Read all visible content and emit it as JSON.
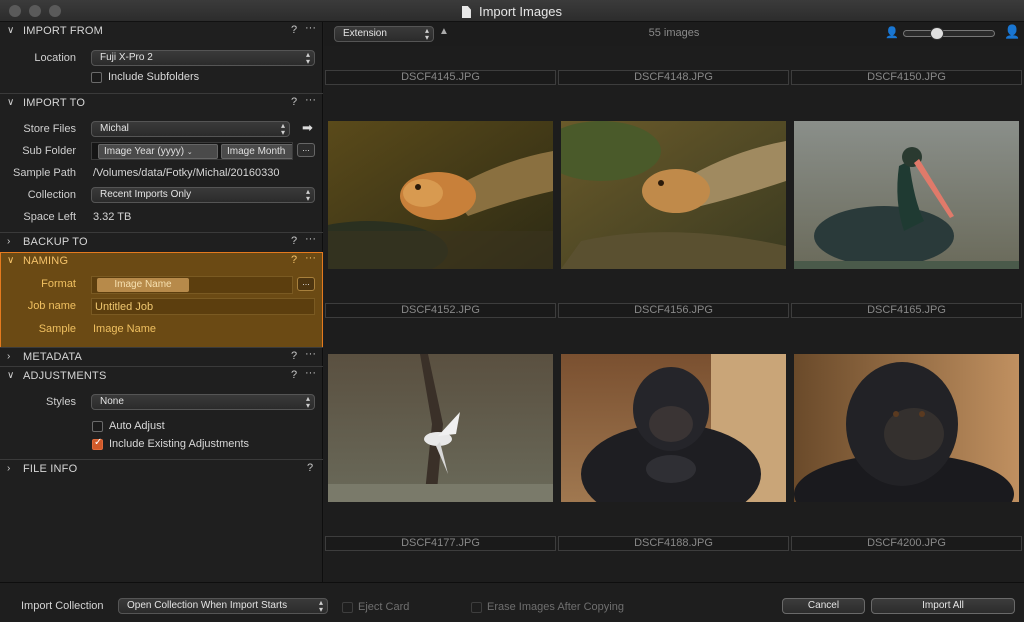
{
  "window": {
    "title": "Import Images"
  },
  "import_from": {
    "title": "IMPORT FROM",
    "location_label": "Location",
    "location_value": "Fuji X-Pro 2",
    "include_subfolders": "Include Subfolders"
  },
  "import_to": {
    "title": "IMPORT TO",
    "store_files_label": "Store Files",
    "store_files_value": "Michal",
    "sub_folder_label": "Sub Folder",
    "sub_folder_tokens": [
      "Image Year (yyyy)",
      "Image Month"
    ],
    "sample_path_label": "Sample Path",
    "sample_path_value": "/Volumes/data/Fotky/Michal/20160330",
    "collection_label": "Collection",
    "collection_value": "Recent Imports Only",
    "space_left_label": "Space Left",
    "space_left_value": "3.32 TB"
  },
  "backup_to": {
    "title": "BACKUP TO"
  },
  "naming": {
    "title": "NAMING",
    "format_label": "Format",
    "format_token": "Image Name",
    "job_name_label": "Job name",
    "job_name_value": "Untitled Job",
    "sample_label": "Sample",
    "sample_value": "Image Name"
  },
  "metadata": {
    "title": "METADATA"
  },
  "adjustments": {
    "title": "ADJUSTMENTS",
    "styles_label": "Styles",
    "styles_value": "None",
    "auto_adjust": "Auto Adjust",
    "include_existing": "Include Existing Adjustments"
  },
  "file_info": {
    "title": "FILE INFO"
  },
  "common": {
    "help": "?",
    "more": "···",
    "ellipsis": "..."
  },
  "browser": {
    "sort_value": "Extension",
    "image_count": "55 images",
    "rows": [
      [
        "DSCF4145.JPG",
        "DSCF4148.JPG",
        "DSCF4150.JPG"
      ],
      [
        "DSCF4152.JPG",
        "DSCF4156.JPG",
        "DSCF4165.JPG"
      ],
      [
        "DSCF4177.JPG",
        "DSCF4188.JPG",
        "DSCF4200.JPG"
      ]
    ]
  },
  "footer": {
    "import_collection_label": "Import Collection",
    "import_collection_value": "Open Collection When Import Starts",
    "eject_card": "Eject Card",
    "erase_images": "Erase Images After Copying",
    "cancel": "Cancel",
    "import_all": "Import All"
  },
  "colors": {
    "accent": "#e57a1e",
    "highlight_bg": "#6b4a14",
    "check_on": "#d15a2a"
  }
}
